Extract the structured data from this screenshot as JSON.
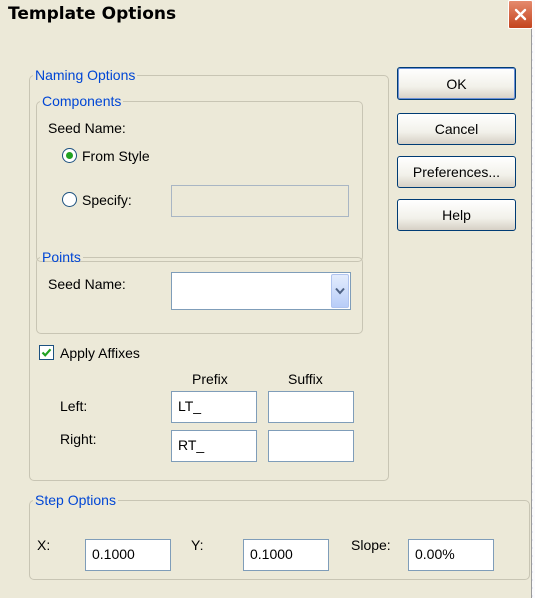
{
  "window": {
    "title": "Template Options"
  },
  "naming_options": {
    "legend": "Naming Options",
    "components": {
      "legend": "Components",
      "seed_name_label": "Seed Name:",
      "from_style_label": "From Style",
      "specify_label": "Specify:",
      "specify_value": "",
      "selected": "From Style"
    },
    "points": {
      "legend": "Points",
      "seed_name_label": "Seed Name:",
      "seed_name_value": ""
    },
    "affixes": {
      "apply_label": "Apply Affixes",
      "checked": true,
      "prefix_header": "Prefix",
      "suffix_header": "Suffix",
      "left_label": "Left:",
      "right_label": "Right:",
      "left_prefix": "LT_",
      "left_suffix": "",
      "right_prefix": "RT_",
      "right_suffix": ""
    }
  },
  "step_options": {
    "legend": "Step Options",
    "x_label": "X:",
    "x_value": "0.1000",
    "y_label": "Y:",
    "y_value": "0.1000",
    "slope_label": "Slope:",
    "slope_value": "0.00%"
  },
  "buttons": {
    "ok": "OK",
    "cancel": "Cancel",
    "preferences": "Preferences...",
    "help": "Help"
  },
  "icons": {
    "close": "close-icon",
    "dropdown": "chevron-down-icon",
    "check": "checkmark-icon"
  },
  "colors": {
    "dialog_bg": "#ece9d8",
    "group_legend": "#0046d5",
    "close_button": "#c4441e",
    "radio_dot": "#21a121"
  }
}
